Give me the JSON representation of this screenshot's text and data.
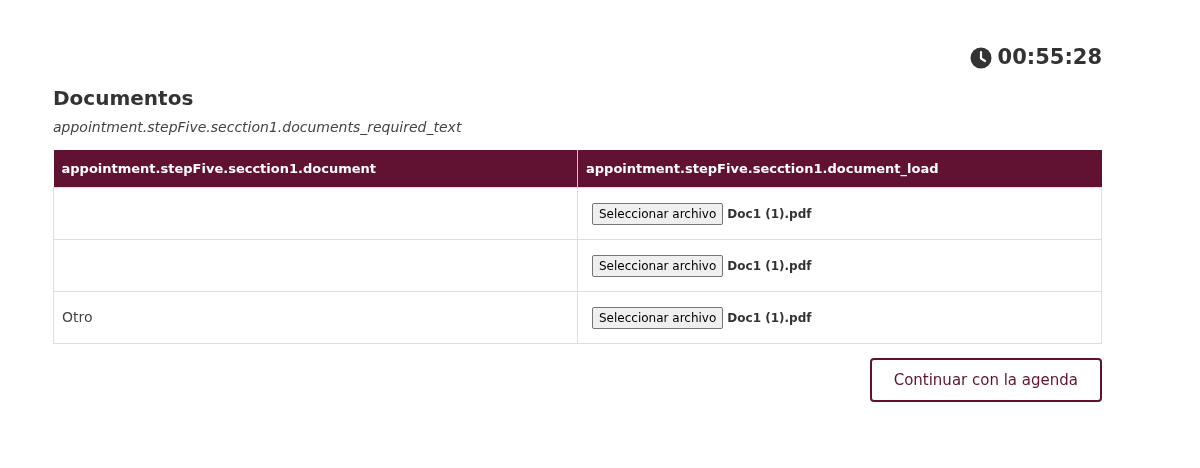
{
  "timer": "00:55:28",
  "title": "Documentos",
  "subtitle": "appointment.stepFive.secction1.documents_required_text",
  "table": {
    "columns": [
      "appointment.stepFive.secction1.document",
      "appointment.stepFive.secction1.document_load"
    ],
    "rows": [
      {
        "file_button": "Seleccionar archivo",
        "file_name": "Doc1 (1).pdf"
      },
      {
        "file_button": "Seleccionar archivo",
        "file_name": "Doc1 (1).pdf"
      },
      {
        "document": "Otro",
        "file_button": "Seleccionar archivo",
        "file_name": "Doc1 (1).pdf"
      }
    ]
  },
  "continue_button": "Continuar con la agenda"
}
